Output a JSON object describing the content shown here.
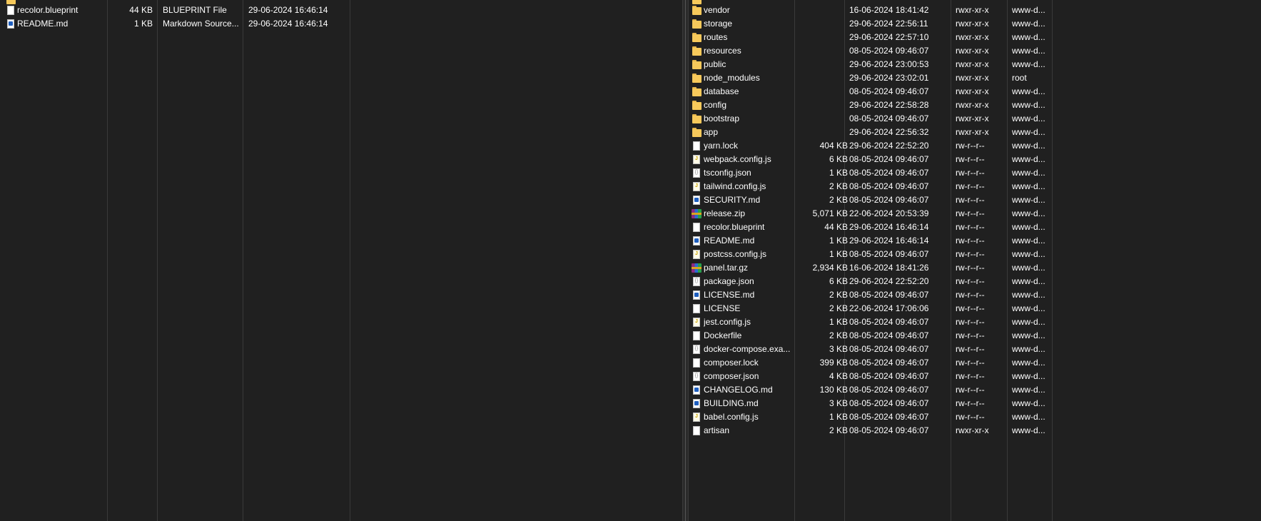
{
  "local": {
    "files": [
      {
        "name": "recolor.blueprint",
        "size": "44 KB",
        "type": "BLUEPRINT File",
        "date": "29-06-2024 16:46:14",
        "icon": "generic-file-icon"
      },
      {
        "name": "README.md",
        "size": "1 KB",
        "type": "Markdown Source...",
        "date": "29-06-2024 16:46:14",
        "icon": "markdown-file-icon"
      }
    ]
  },
  "remote": {
    "files": [
      {
        "name": "vendor",
        "size": "",
        "date": "16-06-2024 18:41:42",
        "perm": "rwxr-xr-x",
        "owner": "www-d...",
        "icon": "folder"
      },
      {
        "name": "storage",
        "size": "",
        "date": "29-06-2024 22:56:11",
        "perm": "rwxr-xr-x",
        "owner": "www-d...",
        "icon": "folder"
      },
      {
        "name": "routes",
        "size": "",
        "date": "29-06-2024 22:57:10",
        "perm": "rwxr-xr-x",
        "owner": "www-d...",
        "icon": "folder"
      },
      {
        "name": "resources",
        "size": "",
        "date": "08-05-2024 09:46:07",
        "perm": "rwxr-xr-x",
        "owner": "www-d...",
        "icon": "folder"
      },
      {
        "name": "public",
        "size": "",
        "date": "29-06-2024 23:00:53",
        "perm": "rwxr-xr-x",
        "owner": "www-d...",
        "icon": "folder"
      },
      {
        "name": "node_modules",
        "size": "",
        "date": "29-06-2024 23:02:01",
        "perm": "rwxr-xr-x",
        "owner": "root",
        "icon": "folder"
      },
      {
        "name": "database",
        "size": "",
        "date": "08-05-2024 09:46:07",
        "perm": "rwxr-xr-x",
        "owner": "www-d...",
        "icon": "folder"
      },
      {
        "name": "config",
        "size": "",
        "date": "29-06-2024 22:58:28",
        "perm": "rwxr-xr-x",
        "owner": "www-d...",
        "icon": "folder"
      },
      {
        "name": "bootstrap",
        "size": "",
        "date": "08-05-2024 09:46:07",
        "perm": "rwxr-xr-x",
        "owner": "www-d...",
        "icon": "folder"
      },
      {
        "name": "app",
        "size": "",
        "date": "29-06-2024 22:56:32",
        "perm": "rwxr-xr-x",
        "owner": "www-d...",
        "icon": "folder"
      },
      {
        "name": "yarn.lock",
        "size": "404 KB",
        "date": "29-06-2024 22:52:20",
        "perm": "rw-r--r--",
        "owner": "www-d...",
        "icon": "generic"
      },
      {
        "name": "webpack.config.js",
        "size": "6 KB",
        "date": "08-05-2024 09:46:07",
        "perm": "rw-r--r--",
        "owner": "www-d...",
        "icon": "js"
      },
      {
        "name": "tsconfig.json",
        "size": "1 KB",
        "date": "08-05-2024 09:46:07",
        "perm": "rw-r--r--",
        "owner": "www-d...",
        "icon": "json"
      },
      {
        "name": "tailwind.config.js",
        "size": "2 KB",
        "date": "08-05-2024 09:46:07",
        "perm": "rw-r--r--",
        "owner": "www-d...",
        "icon": "js"
      },
      {
        "name": "SECURITY.md",
        "size": "2 KB",
        "date": "08-05-2024 09:46:07",
        "perm": "rw-r--r--",
        "owner": "www-d...",
        "icon": "md"
      },
      {
        "name": "release.zip",
        "size": "5,071 KB",
        "date": "22-06-2024 20:53:39",
        "perm": "rw-r--r--",
        "owner": "www-d...",
        "icon": "zip"
      },
      {
        "name": "recolor.blueprint",
        "size": "44 KB",
        "date": "29-06-2024 16:46:14",
        "perm": "rw-r--r--",
        "owner": "www-d...",
        "icon": "generic"
      },
      {
        "name": "README.md",
        "size": "1 KB",
        "date": "29-06-2024 16:46:14",
        "perm": "rw-r--r--",
        "owner": "www-d...",
        "icon": "md"
      },
      {
        "name": "postcss.config.js",
        "size": "1 KB",
        "date": "08-05-2024 09:46:07",
        "perm": "rw-r--r--",
        "owner": "www-d...",
        "icon": "js"
      },
      {
        "name": "panel.tar.gz",
        "size": "2,934 KB",
        "date": "16-06-2024 18:41:26",
        "perm": "rw-r--r--",
        "owner": "www-d...",
        "icon": "zip"
      },
      {
        "name": "package.json",
        "size": "6 KB",
        "date": "29-06-2024 22:52:20",
        "perm": "rw-r--r--",
        "owner": "www-d...",
        "icon": "json"
      },
      {
        "name": "LICENSE.md",
        "size": "2 KB",
        "date": "08-05-2024 09:46:07",
        "perm": "rw-r--r--",
        "owner": "www-d...",
        "icon": "md"
      },
      {
        "name": "LICENSE",
        "size": "2 KB",
        "date": "22-06-2024 17:06:06",
        "perm": "rw-r--r--",
        "owner": "www-d...",
        "icon": "generic"
      },
      {
        "name": "jest.config.js",
        "size": "1 KB",
        "date": "08-05-2024 09:46:07",
        "perm": "rw-r--r--",
        "owner": "www-d...",
        "icon": "js"
      },
      {
        "name": "Dockerfile",
        "size": "2 KB",
        "date": "08-05-2024 09:46:07",
        "perm": "rw-r--r--",
        "owner": "www-d...",
        "icon": "generic"
      },
      {
        "name": "docker-compose.exa...",
        "size": "3 KB",
        "date": "08-05-2024 09:46:07",
        "perm": "rw-r--r--",
        "owner": "www-d...",
        "icon": "json"
      },
      {
        "name": "composer.lock",
        "size": "399 KB",
        "date": "08-05-2024 09:46:07",
        "perm": "rw-r--r--",
        "owner": "www-d...",
        "icon": "generic"
      },
      {
        "name": "composer.json",
        "size": "4 KB",
        "date": "08-05-2024 09:46:07",
        "perm": "rw-r--r--",
        "owner": "www-d...",
        "icon": "json"
      },
      {
        "name": "CHANGELOG.md",
        "size": "130 KB",
        "date": "08-05-2024 09:46:07",
        "perm": "rw-r--r--",
        "owner": "www-d...",
        "icon": "md"
      },
      {
        "name": "BUILDING.md",
        "size": "3 KB",
        "date": "08-05-2024 09:46:07",
        "perm": "rw-r--r--",
        "owner": "www-d...",
        "icon": "md"
      },
      {
        "name": "babel.config.js",
        "size": "1 KB",
        "date": "08-05-2024 09:46:07",
        "perm": "rw-r--r--",
        "owner": "www-d...",
        "icon": "js"
      },
      {
        "name": "artisan",
        "size": "2 KB",
        "date": "08-05-2024 09:46:07",
        "perm": "rwxr-xr-x",
        "owner": "www-d...",
        "icon": "generic"
      }
    ]
  }
}
